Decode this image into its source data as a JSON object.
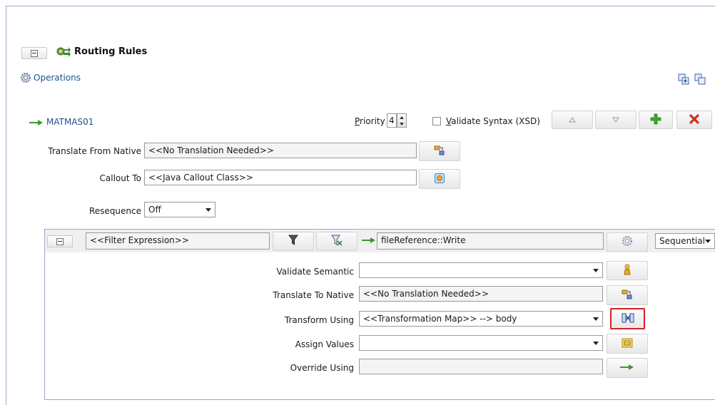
{
  "routing_rules": {
    "title": "Routing Rules"
  },
  "operations": {
    "label": "Operations"
  },
  "rule": {
    "name": "MATMAS01",
    "priority_label": "Priority",
    "priority_value": "4",
    "validate_syntax_label": "Validate Syntax (XSD)",
    "translate_from_native_label": "Translate From Native",
    "translate_from_native_value": "<<No Translation Needed>>",
    "callout_to_label": "Callout To",
    "callout_to_value": "<<Java Callout Class>>",
    "resequence_label": "Resequence",
    "resequence_value": "Off"
  },
  "filter": {
    "expression": "<<Filter Expression>>",
    "target": "fileReference::Write",
    "mode": "Sequential",
    "validate_semantic_label": "Validate Semantic",
    "validate_semantic_value": "",
    "translate_to_native_label": "Translate To Native",
    "translate_to_native_value": "<<No Translation Needed>>",
    "transform_using_label": "Transform Using",
    "transform_using_value": "<<Transformation Map>> --> body",
    "assign_values_label": "Assign Values",
    "assign_values_value": "",
    "override_using_label": "Override Using",
    "override_using_value": ""
  },
  "icons": {
    "routing": "routing-rules-icon",
    "operations": "gear-icon",
    "add": "plus-icon",
    "delete": "x-icon",
    "highlight_color": "#d32027"
  }
}
